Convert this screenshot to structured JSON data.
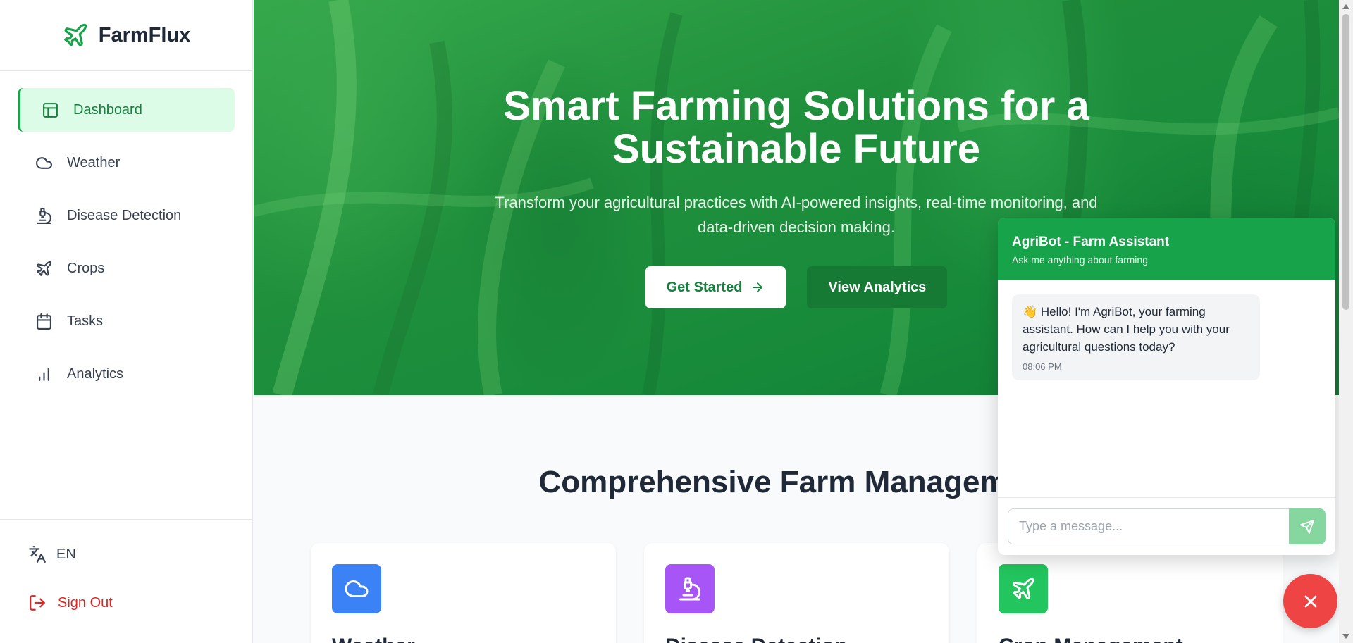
{
  "brand": {
    "name": "FarmFlux",
    "icon": "plane-icon",
    "accent": "#16a34a"
  },
  "sidebar": {
    "items": [
      {
        "label": "Dashboard",
        "icon": "layout-icon",
        "active": true
      },
      {
        "label": "Weather",
        "icon": "cloud-icon"
      },
      {
        "label": "Disease Detection",
        "icon": "microscope-icon"
      },
      {
        "label": "Crops",
        "icon": "plane-icon"
      },
      {
        "label": "Tasks",
        "icon": "calendar-icon"
      },
      {
        "label": "Analytics",
        "icon": "bar-chart-icon"
      }
    ],
    "language": "EN",
    "signout": "Sign Out"
  },
  "hero": {
    "title": "Smart Farming Solutions for a Sustainable Future",
    "subtitle": "Transform your agricultural practices with AI-powered insights, real-time monitoring, and data-driven decision making.",
    "primary_cta": "Get Started",
    "secondary_cta": "View Analytics"
  },
  "features": {
    "title": "Comprehensive Farm Management",
    "cards": [
      {
        "title": "Weather",
        "icon": "cloud-icon",
        "color": "#3b82f6"
      },
      {
        "title": "Disease Detection",
        "icon": "microscope-icon",
        "color": "#a855f7"
      },
      {
        "title": "Crop Management",
        "icon": "plane-icon",
        "color": "#22c55e"
      }
    ]
  },
  "chat": {
    "title": "AgriBot - Farm Assistant",
    "subtitle": "Ask me anything about farming",
    "message": "👋 Hello! I'm AgriBot, your farming assistant. How can I help you with your agricultural questions today?",
    "time": "08:06 PM",
    "placeholder": "Type a message...",
    "send_color": "#86d6a0",
    "close_color": "#ef4444"
  }
}
